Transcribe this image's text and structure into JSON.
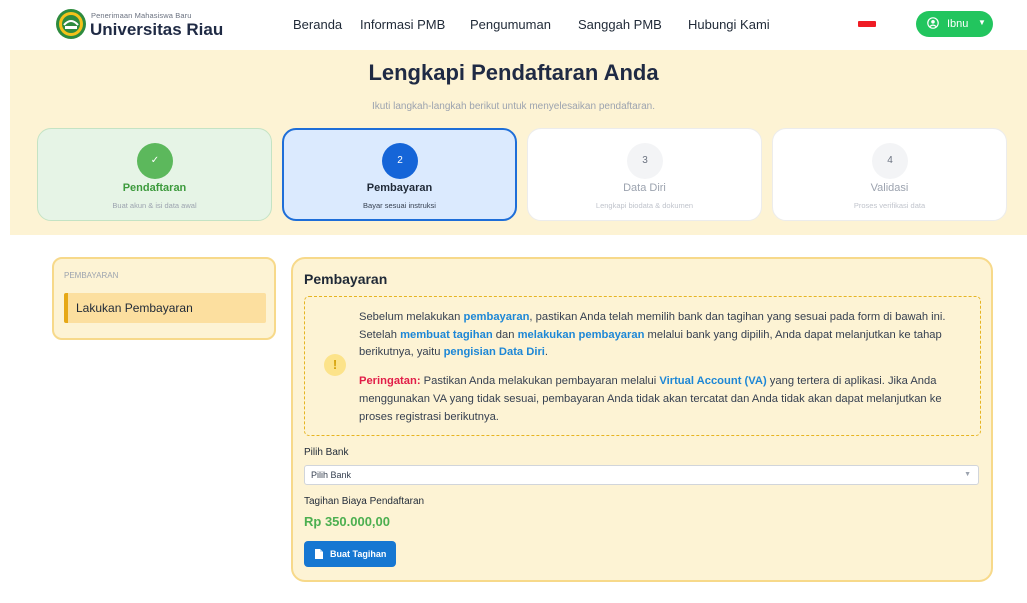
{
  "header": {
    "brand_sub": "Penerimaan Mahasiswa Baru",
    "brand_main": "Universitas Riau",
    "nav": [
      "Beranda",
      "Informasi PMB",
      "Pengumuman",
      "Sanggah PMB",
      "Hubungi Kami"
    ],
    "user_name": "Ibnu",
    "user_icon": "user-circle-icon",
    "caret_icon": "chevron-down-icon",
    "flag_color": "#ef1c24",
    "user_button_color": "#22c55e"
  },
  "hero": {
    "title": "Lengkapi Pendaftaran Anda",
    "subtitle": "Ikuti langkah-langkah berikut untuk menyelesaikan pendaftaran."
  },
  "steps": [
    {
      "marker": "✓",
      "title": "Pendaftaran",
      "desc": "Buat akun & isi data awal",
      "state": "done"
    },
    {
      "marker": "2",
      "title": "Pembayaran",
      "desc": "Bayar sesuai instruksi",
      "state": "active"
    },
    {
      "marker": "3",
      "title": "Data Diri",
      "desc": "Lengkapi biodata & dokumen",
      "state": "pending"
    },
    {
      "marker": "4",
      "title": "Validasi",
      "desc": "Proses verifikasi data",
      "state": "pending"
    }
  ],
  "sidebar": {
    "heading": "PEMBAYARAN",
    "items": [
      {
        "label": "Lakukan Pembayaran"
      }
    ]
  },
  "main": {
    "title": "Pembayaran",
    "alert": {
      "icon": "!",
      "p1": [
        "Sebelum melakukan ",
        "pembayaran",
        ", pastikan Anda telah memilih bank dan tagihan yang sesuai pada form di bawah ini. Setelah ",
        "membuat tagihan",
        " dan ",
        "melakukan pembayaran",
        " melalui bank yang dipilih, Anda dapat melanjutkan ke tahap berikutnya, yaitu ",
        "pengisian Data Diri",
        "."
      ],
      "p2": [
        "Peringatan:",
        " Pastikan Anda melakukan pembayaran melalui ",
        "Virtual Account (VA)",
        " yang tertera di aplikasi. Jika Anda menggunakan VA yang tidak sesuai, pembayaran Anda tidak akan tercatat dan Anda tidak akan dapat melanjutkan ke proses registrasi berikutnya."
      ]
    },
    "bank_label": "Pilih Bank",
    "bank_selected": "Pilih Bank",
    "fee_label": "Tagihan Biaya Pendaftaran",
    "fee_amount": "Rp 350.000,00",
    "button_label": "Buat Tagihan",
    "button_icon": "document-icon"
  }
}
